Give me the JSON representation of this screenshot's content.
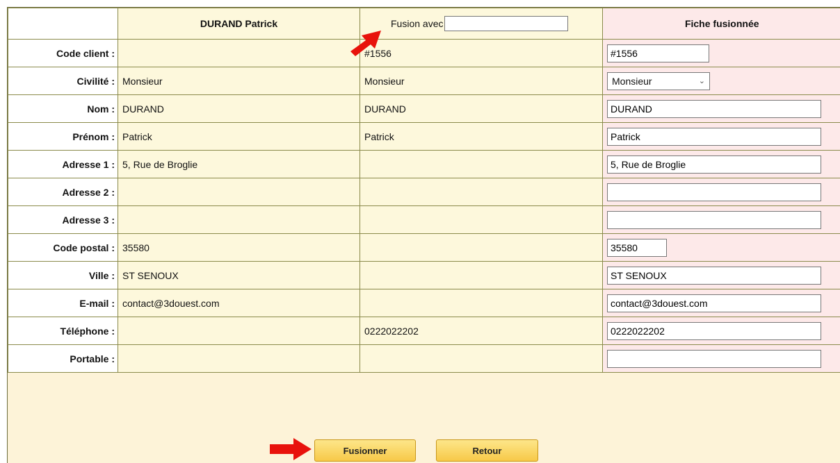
{
  "header": {
    "col1_title": "DURAND Patrick",
    "fusion_label": "Fusion avec",
    "fusion_value": "",
    "col3_title": "Fiche fusionnée"
  },
  "rows": [
    {
      "label": "Code client :",
      "c1": "",
      "c2": "#1556",
      "merged": "#1556"
    },
    {
      "label": "Civilité :",
      "c1": "Monsieur",
      "c2": "Monsieur",
      "merged": "Monsieur"
    },
    {
      "label": "Nom :",
      "c1": "DURAND",
      "c2": "DURAND",
      "merged": "DURAND"
    },
    {
      "label": "Prénom :",
      "c1": "Patrick",
      "c2": "Patrick",
      "merged": "Patrick"
    },
    {
      "label": "Adresse 1 :",
      "c1": "5, Rue de Broglie",
      "c2": "",
      "merged": "5, Rue de Broglie"
    },
    {
      "label": "Adresse 2 :",
      "c1": "",
      "c2": "",
      "merged": ""
    },
    {
      "label": "Adresse 3 :",
      "c1": "",
      "c2": "",
      "merged": ""
    },
    {
      "label": "Code postal :",
      "c1": "35580",
      "c2": "",
      "merged": "35580"
    },
    {
      "label": "Ville :",
      "c1": "ST SENOUX",
      "c2": "",
      "merged": "ST SENOUX"
    },
    {
      "label": "E-mail :",
      "c1": "contact@3douest.com",
      "c2": "",
      "merged": "contact@3douest.com"
    },
    {
      "label": "Téléphone :",
      "c1": "",
      "c2": "0222022202",
      "merged": "0222022202"
    },
    {
      "label": "Portable :",
      "c1": "",
      "c2": "",
      "merged": ""
    }
  ],
  "buttons": {
    "merge": "Fusionner",
    "back": "Retour"
  },
  "colors": {
    "panel_bg": "#fdf3d8",
    "merged_col_bg": "#fde9e9",
    "arrow": "#e8120c",
    "button": "#f7c948"
  }
}
